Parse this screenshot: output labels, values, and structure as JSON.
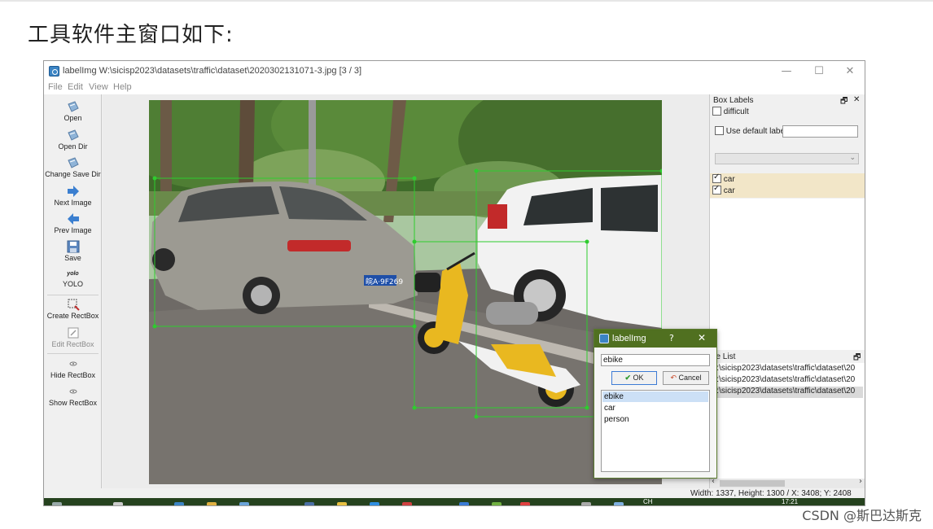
{
  "page": {
    "heading": "工具软件主窗口如下:",
    "watermark": "CSDN @斯巴达斯克"
  },
  "window": {
    "title": "labelImg W:\\sicisp2023\\datasets\\traffic\\dataset\\2020302131071-3.jpg [3 / 3]",
    "controls": {
      "minimize": "—",
      "maximize": "☐",
      "close": "✕"
    }
  },
  "menu": [
    "File",
    "Edit",
    "View",
    "Help"
  ],
  "toolbar": {
    "open": "Open",
    "open_dir": "Open Dir",
    "change_save_dir": "Change Save Dir",
    "next_image": "Next Image",
    "prev_image": "Prev Image",
    "save": "Save",
    "yolo_icon_text": "yolo",
    "yolo": "YOLO",
    "create_rectbox": "Create RectBox",
    "edit_rectbox": "Edit RectBox",
    "hide_rectbox": "Hide RectBox",
    "show_rectbox": "Show RectBox"
  },
  "box_labels": {
    "title": "Box Labels",
    "float_icon": "🗗",
    "close_icon": "✕",
    "difficult": "difficult",
    "use_default_label": "Use default label",
    "default_label_value": "",
    "dropdown_value": "",
    "labels": [
      {
        "text": "car",
        "checked": true
      },
      {
        "text": "car",
        "checked": true
      }
    ]
  },
  "file_list": {
    "title": "ile List",
    "float_icon": "🗗",
    "items": [
      "V:\\sicisp2023\\datasets\\traffic\\dataset\\20",
      "V:\\sicisp2023\\datasets\\traffic\\dataset\\20",
      "V:\\sicisp2023\\datasets\\traffic\\dataset\\20"
    ],
    "selected_index": 2
  },
  "status": {
    "text": "Width: 1337, Height: 1300 / X: 3408; Y: 2408"
  },
  "taskbar": {
    "lang": "CH",
    "time": "17:21"
  },
  "dialog": {
    "title": "labelImg",
    "help": "?",
    "close": "✕",
    "input_value": "ebike",
    "ok_label": "OK",
    "cancel_label": "Cancel",
    "items": [
      "ebike",
      "car",
      "person"
    ],
    "selected_index": 0
  },
  "photo": {
    "plate_text": "皖A·9F269",
    "colors": {
      "box_green": "#2ecc2e",
      "sky": "#a9c7a0",
      "foliage": "#3f6b2a",
      "asphalt": "#6e6a66",
      "silver_car": "#9c9a92",
      "white_car": "#f2f2f2",
      "scooter_yellow": "#e9b820"
    }
  }
}
